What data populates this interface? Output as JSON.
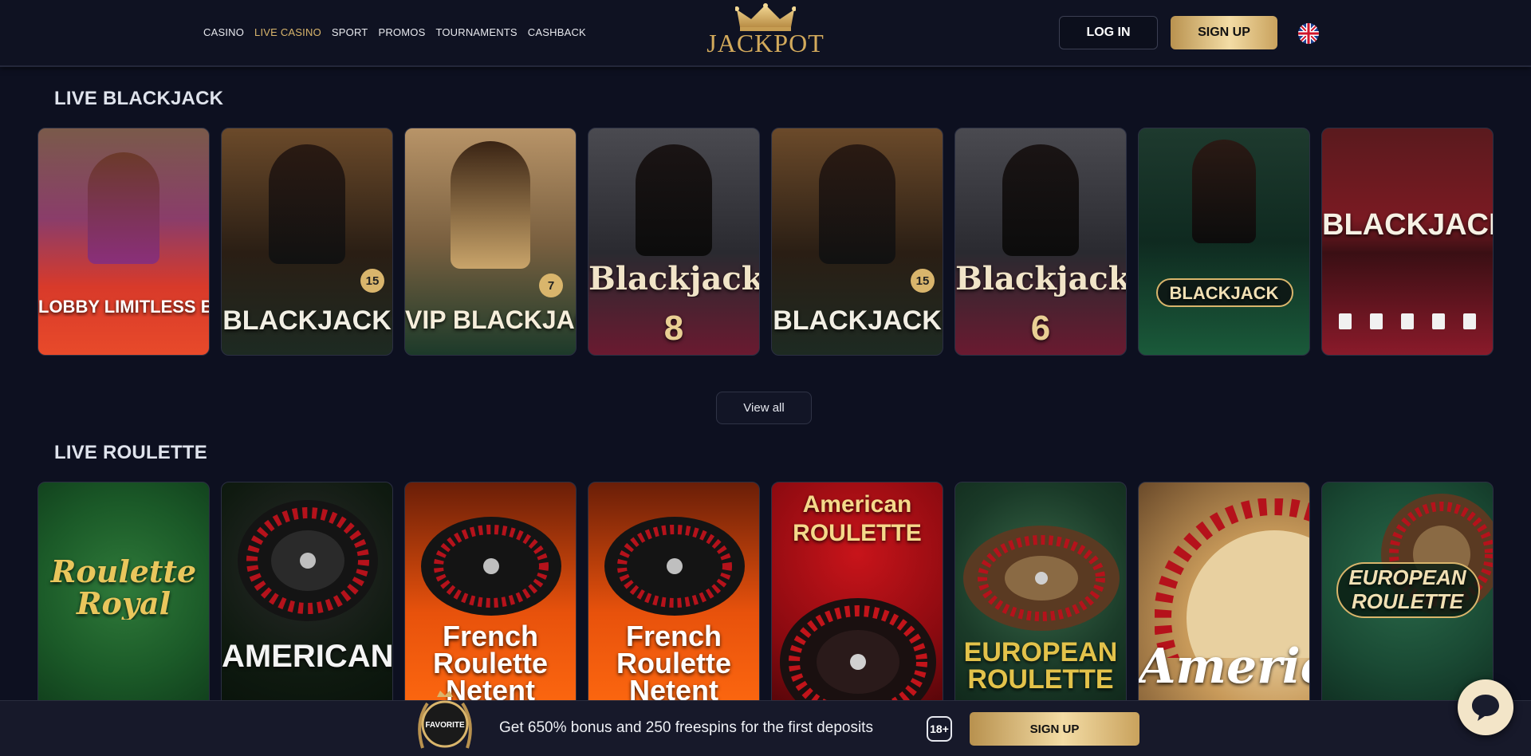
{
  "nav": {
    "items": [
      "CASINO",
      "LIVE CASINO",
      "SPORT",
      "PROMOS",
      "TOURNAMENTS",
      "CASHBACK"
    ],
    "active": "LIVE CASINO"
  },
  "logo": {
    "text": "JACKPOT"
  },
  "header": {
    "login_label": "LOG IN",
    "signup_label": "SIGN UP",
    "language_icon": "uk-flag-icon"
  },
  "blackjack": {
    "title": "LIVE BLACKJACK",
    "games": [
      {
        "label": "LOBBY LIMITLESS BLACKJACK",
        "badge": ""
      },
      {
        "label": "BLACKJACK",
        "badge": "15"
      },
      {
        "label": "VIP BLACKJACK",
        "badge": "7"
      },
      {
        "label": "Blackjack",
        "badge": "8"
      },
      {
        "label": "BLACKJACK",
        "badge": "15"
      },
      {
        "label": "Blackjack",
        "badge": "6"
      },
      {
        "label": "BLACKJACK",
        "badge": ""
      },
      {
        "label": "BLACKJACK X",
        "badge": ""
      }
    ],
    "view_all": "View all"
  },
  "roulette": {
    "title": "LIVE ROULETTE",
    "games": [
      {
        "label": "Roulette Royal"
      },
      {
        "label": "AMERICAN ROULETTE"
      },
      {
        "label": "French Roulette Netent"
      },
      {
        "label": "French Roulette Netent"
      },
      {
        "label": "American ROULETTE"
      },
      {
        "label": "EUROPEAN ROULETTE"
      },
      {
        "label": "American"
      },
      {
        "label": "EUROPEAN ROULETTE"
      }
    ]
  },
  "banner": {
    "badge": "FAVORITE",
    "text": "Get 650% bonus and 250 freespins for the first deposits",
    "age": "18+",
    "signup_label": "SIGN UP"
  },
  "colors": {
    "background": "#0d1020",
    "gold": "#d9b56c",
    "header": "#0f1222"
  }
}
